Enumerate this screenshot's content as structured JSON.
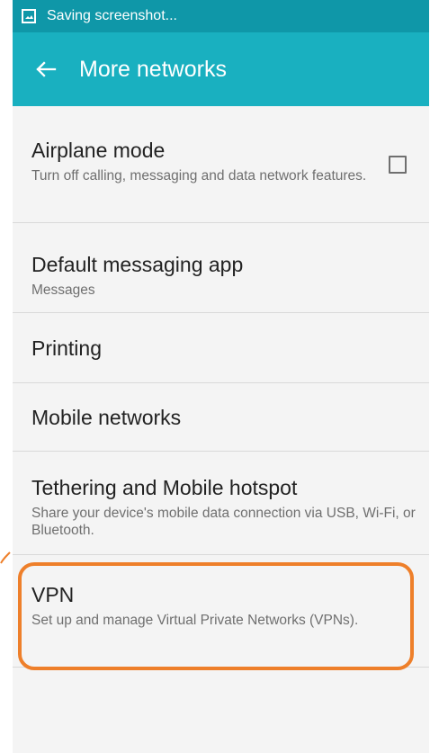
{
  "status_bar": {
    "text": "Saving screenshot..."
  },
  "app_bar": {
    "title": "More networks"
  },
  "items": [
    {
      "title": "Airplane mode",
      "subtitle": "Turn off calling, messaging and data network features."
    },
    {
      "title": "Default messaging app",
      "subtitle": "Messages"
    },
    {
      "title": "Printing"
    },
    {
      "title": "Mobile networks"
    },
    {
      "title": "Tethering and Mobile hotspot",
      "subtitle": "Share your device's mobile data connection via USB, Wi-Fi, or Bluetooth."
    },
    {
      "title": "VPN",
      "subtitle": "Set up and manage Virtual Private Networks (VPNs)."
    }
  ],
  "toggles": {
    "airplane_mode_checked": false
  },
  "colors": {
    "status_bar": "#0f97a8",
    "app_bar": "#19b0c0",
    "highlight": "#ee7f2a"
  },
  "icons": {
    "status": "screenshot-icon",
    "back": "back-arrow-icon",
    "checkbox": "checkbox-unchecked-icon"
  }
}
